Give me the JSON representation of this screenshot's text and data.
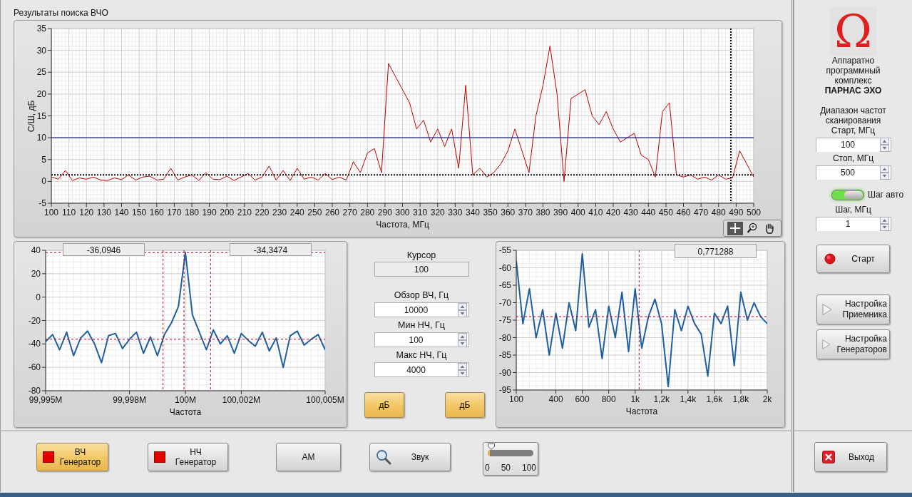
{
  "panel_title": "Результаты поиска ВЧО",
  "main_chart": {
    "chart_data": {
      "type": "line",
      "xlabel": "Частота, МГц",
      "ylabel": "С/Ш, дБ",
      "x": [
        100,
        104,
        108,
        112,
        116,
        120,
        124,
        128,
        132,
        136,
        140,
        144,
        148,
        152,
        156,
        160,
        164,
        168,
        172,
        176,
        180,
        184,
        188,
        192,
        196,
        200,
        204,
        208,
        212,
        216,
        220,
        224,
        228,
        232,
        236,
        240,
        244,
        248,
        252,
        256,
        260,
        264,
        268,
        272,
        276,
        280,
        284,
        288,
        292,
        296,
        300,
        304,
        308,
        312,
        316,
        320,
        324,
        328,
        332,
        336,
        340,
        344,
        348,
        352,
        356,
        360,
        364,
        368,
        372,
        376,
        380,
        384,
        388,
        392,
        396,
        400,
        404,
        408,
        412,
        416,
        420,
        424,
        428,
        432,
        436,
        440,
        444,
        448,
        452,
        456,
        460,
        464,
        468,
        472,
        476,
        480,
        484,
        488,
        492,
        496,
        500
      ],
      "grid": true,
      "series": [
        {
          "color": "#c00000",
          "values": [
            1,
            0.5,
            2.5,
            0.2,
            0.8,
            0.5,
            1,
            0.3,
            0.2,
            0.8,
            0.4,
            1.5,
            0.3,
            1,
            1.2,
            0.3,
            0.5,
            3,
            0.3,
            1,
            1.5,
            0.2,
            2,
            0.5,
            0.4,
            1.2,
            0.2,
            1,
            1.8,
            0.3,
            1,
            3.5,
            0.3,
            2.5,
            0.2,
            3,
            0.5,
            1,
            0.3,
            1.8,
            0.4,
            1,
            0.3,
            4.5,
            2,
            6.5,
            7.5,
            2,
            27,
            24,
            21,
            18,
            12,
            14,
            9,
            12,
            8,
            12,
            3,
            22,
            1.5,
            3,
            1,
            2,
            4,
            7,
            12,
            7,
            2,
            15,
            22,
            31,
            20,
            0,
            19,
            20,
            21,
            15,
            13,
            16,
            12,
            9,
            10,
            11,
            6,
            5,
            1,
            16,
            18,
            1.5,
            1,
            1.5,
            0.5,
            1,
            0.3,
            1.5,
            0.5,
            0.8,
            7,
            4,
            1
          ]
        }
      ],
      "xlim": [
        100,
        500
      ],
      "ylim": [
        -5,
        35
      ],
      "xticks": [
        100,
        110,
        120,
        130,
        140,
        150,
        160,
        170,
        180,
        190,
        200,
        210,
        220,
        230,
        240,
        250,
        260,
        270,
        280,
        290,
        300,
        310,
        320,
        330,
        340,
        350,
        360,
        370,
        380,
        390,
        400,
        410,
        420,
        430,
        440,
        450,
        460,
        470,
        480,
        490,
        500
      ],
      "yticks": [
        -5,
        0,
        5,
        10,
        15,
        20,
        25,
        30,
        35
      ],
      "ref_lines": [
        {
          "axis": "y",
          "value": 10
        },
        {
          "axis": "y",
          "value": 1.5
        },
        {
          "axis": "x",
          "value": 487
        }
      ]
    },
    "tools": [
      {
        "kind": "crosshair",
        "selected": true
      },
      {
        "kind": "zoom",
        "selected": false
      },
      {
        "kind": "pan",
        "selected": false
      }
    ]
  },
  "spectrum_chart": {
    "readouts": [
      "-36,0946",
      "-34,3474"
    ],
    "chart_data": {
      "type": "line",
      "xlabel": "Частота",
      "grid": true,
      "categories": [
        "99,995M",
        null,
        null,
        null,
        null,
        null,
        null,
        null,
        null,
        null,
        null,
        null,
        "99,998M",
        null,
        null,
        null,
        null,
        null,
        null,
        null,
        "100M",
        null,
        null,
        null,
        null,
        null,
        null,
        null,
        "100,002M",
        null,
        null,
        null,
        null,
        null,
        null,
        null,
        null,
        null,
        null,
        null,
        "100,005M"
      ],
      "series": [
        {
          "color": "#1f5f9f",
          "values": [
            -38,
            -32,
            -45,
            -30,
            -50,
            -35,
            -29,
            -40,
            -56,
            -33,
            -31,
            -44,
            -36,
            -30,
            -48,
            -34,
            -50,
            -32,
            -22,
            -8,
            38,
            -15,
            -30,
            -45,
            -28,
            -40,
            -33,
            -48,
            -31,
            -37,
            -42,
            -30,
            -46,
            -35,
            -60,
            -33,
            -29,
            -41,
            -36,
            -32,
            -45
          ]
        }
      ],
      "ylim": [
        -80,
        40
      ],
      "yticks": [
        -80,
        -60,
        -40,
        -20,
        0,
        20,
        40
      ],
      "ref_lines": [
        {
          "axis": "y",
          "value": -36
        },
        {
          "axis": "y",
          "value": 38
        }
      ]
    }
  },
  "settings": {
    "cursor": {
      "label": "Курсор",
      "value": "100"
    },
    "fields": [
      {
        "label": "Обзор ВЧ, Гц",
        "value": "10000"
      },
      {
        "label": "Мин НЧ, Гц",
        "value": "100"
      },
      {
        "label": "Макс НЧ, Гц",
        "value": "4000"
      }
    ],
    "db_buttons": [
      {
        "label": "дБ"
      },
      {
        "label": "дБ"
      }
    ]
  },
  "audio_chart": {
    "readouts": [
      "0,771288"
    ],
    "chart_data": {
      "type": "line",
      "xlabel": "Частота",
      "x": [
        100,
        150,
        200,
        250,
        300,
        350,
        400,
        450,
        500,
        550,
        600,
        650,
        700,
        750,
        800,
        850,
        900,
        950,
        1000,
        1050,
        1100,
        1150,
        1200,
        1250,
        1300,
        1350,
        1400,
        1450,
        1500,
        1550,
        1600,
        1650,
        1700,
        1750,
        1800,
        1850,
        1900,
        1950,
        2000
      ],
      "grid": true,
      "series": [
        {
          "color": "#1f5f9f",
          "values": [
            -58,
            -76,
            -66,
            -80,
            -72,
            -85,
            -73,
            -83,
            -70,
            -78,
            -56,
            -77,
            -72,
            -86,
            -71,
            -80,
            -67,
            -84,
            -66,
            -83,
            -74,
            -69,
            -76,
            -94,
            -72,
            -78,
            -71,
            -76,
            -79,
            -91,
            -73,
            -76,
            -71,
            -88,
            -67,
            -75,
            -70,
            -74,
            -76
          ]
        }
      ],
      "xlim": [
        100,
        2000
      ],
      "ylim": [
        -95,
        -55
      ],
      "xticks": [
        100,
        400,
        600,
        800,
        {
          "value": 1000,
          "label": "1k"
        },
        {
          "value": 1200,
          "label": "1,2k"
        },
        {
          "value": 1400,
          "label": "1,4k"
        },
        {
          "value": 1600,
          "label": "1,6k"
        },
        {
          "value": 1800,
          "label": "1,8k"
        },
        {
          "value": 2000,
          "label": "2k"
        }
      ],
      "yticks": [
        -95,
        -90,
        -85,
        -80,
        -75,
        -70,
        -65,
        -60,
        -55
      ],
      "ref_lines": [
        {
          "axis": "y",
          "value": -74
        },
        {
          "axis": "x",
          "value": 1030
        }
      ]
    }
  },
  "sidebar": {
    "logo": "Ω",
    "description": "Аппаратно программный комплекс",
    "product": "ПАРНАС ЭХО",
    "range_label": "Диапазон частот сканирования",
    "range_fields": [
      {
        "label": "Старт, МГц",
        "value": "100"
      },
      {
        "label": "Стоп, МГц",
        "value": "500"
      }
    ],
    "auto_step": {
      "label": "Шаг авто",
      "on": true
    },
    "step_field": {
      "label": "Шаг, МГц",
      "value": "1"
    },
    "buttons": [
      {
        "kind": "start",
        "label": "Старт"
      },
      {
        "kind": "settings",
        "label": "Настройка\nПриемника"
      },
      {
        "kind": "settings",
        "label": "Настройка\nГенераторов"
      }
    ],
    "exit_button": {
      "kind": "exit",
      "label": "Выход"
    }
  },
  "bottom_bar": {
    "buttons": [
      {
        "kind": "generator",
        "label": "ВЧ\nГенератор",
        "selected": true
      },
      {
        "kind": "generator",
        "label": "НЧ\nГенератор",
        "selected": false
      },
      {
        "kind": "plain",
        "label": "АМ",
        "selected": false
      },
      {
        "kind": "sound",
        "label": "Звук",
        "selected": false
      }
    ],
    "volume": {
      "level": 0.05,
      "ticks": [
        "0",
        "50",
        "100"
      ]
    }
  }
}
